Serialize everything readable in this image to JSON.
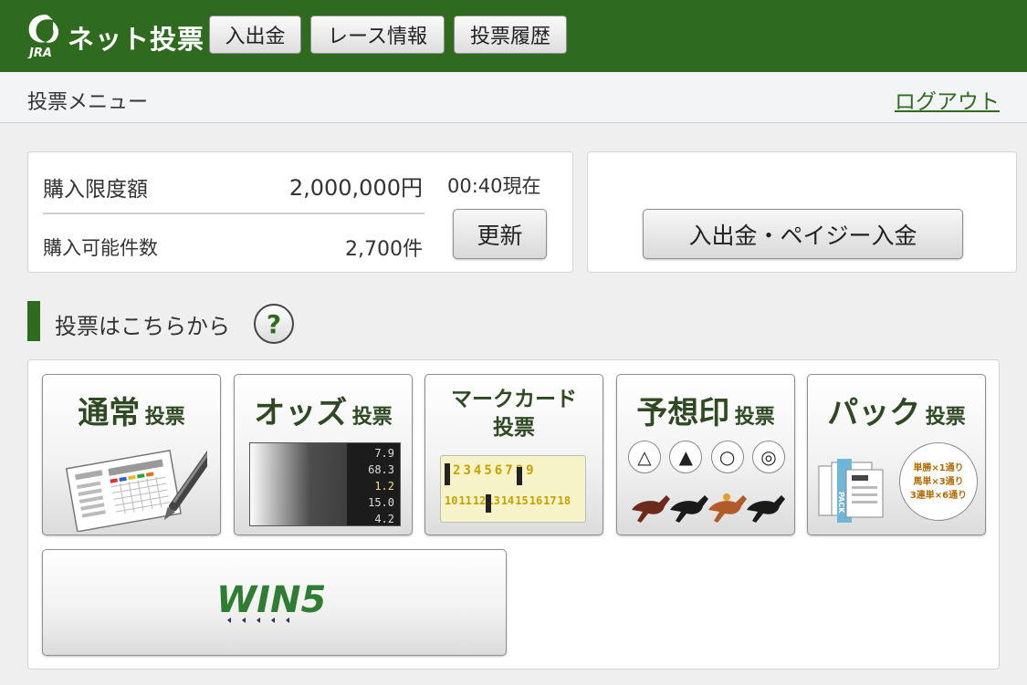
{
  "header": {
    "logo_text": "ネット投票",
    "logo_sub": "JRA",
    "nav": [
      "入出金",
      "レース情報",
      "投票履歴"
    ]
  },
  "subbar": {
    "title": "投票メニュー",
    "logout": "ログアウト"
  },
  "limit_panel": {
    "purchase_limit_label": "購入限度額",
    "purchase_limit_value": "2,000,000円",
    "timestamp": "00:40現在",
    "available_count_label": "購入可能件数",
    "available_count_value": "2,700件",
    "refresh_button": "更新"
  },
  "deposit_panel": {
    "deposit_button": "入出金・ペイジー入金"
  },
  "vote_section": {
    "heading": "投票はこちらから",
    "help": "?",
    "cards": [
      {
        "title_main": "通常",
        "title_sub": "投票"
      },
      {
        "title_main": "オッズ",
        "title_sub": "投票",
        "odds": [
          "7.9",
          "68.3",
          "1.2",
          "15.0",
          "4.2"
        ]
      },
      {
        "title_line1": "マークカード",
        "title_line2": "投票",
        "numbers_top": [
          "1",
          "2",
          "3",
          "4",
          "5",
          "6",
          "7",
          "8",
          "9"
        ],
        "numbers_bottom": [
          "10",
          "11",
          "12",
          "13",
          "14",
          "15",
          "16",
          "17",
          "18"
        ]
      },
      {
        "title_main": "予想印",
        "title_sub": "投票",
        "marks": [
          "△",
          "▲",
          "○",
          "◎"
        ]
      },
      {
        "title_main": "パック",
        "title_sub": "投票",
        "pack_label": "PACK",
        "bubble": [
          "単勝×1通り",
          "馬単×3通り",
          "3連単×6通り"
        ]
      }
    ],
    "win5_label": "WIN5"
  },
  "colors": {
    "brand_green": "#2e6b1f",
    "win5_green": "#2e7d32",
    "win5_navy": "#1f2a6b"
  }
}
